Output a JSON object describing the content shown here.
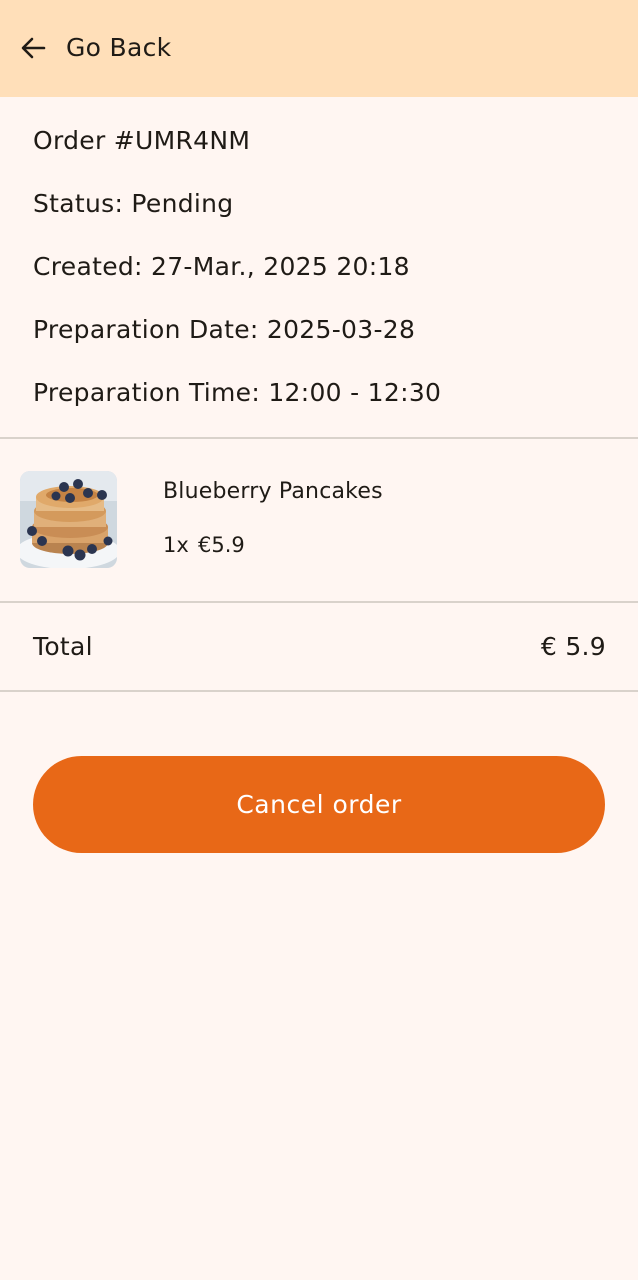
{
  "app_bar": {
    "back_icon": "arrow-back-icon",
    "back_label": "Go Back"
  },
  "order": {
    "number": "Order #UMR4NM",
    "status": "Status: Pending",
    "created": "Created: 27-Mar., 2025 20:18",
    "preparation_date": "Preparation Date: 2025-03-28",
    "preparation_time": "Preparation Time: 12:00 - 12:30"
  },
  "items": [
    {
      "name": "Blueberry Pancakes",
      "quantity": "1x",
      "price": "€5.9",
      "image": "blueberry-pancakes-photo"
    }
  ],
  "total": {
    "label": "Total",
    "value": "€ 5.9"
  },
  "actions": {
    "cancel_label": "Cancel order"
  },
  "colors": {
    "background": "#fff6f2",
    "app_bar": "#ffdfb9",
    "accent": "#e86817",
    "divider": "#d9d2cb",
    "text": "#1f1b16"
  }
}
